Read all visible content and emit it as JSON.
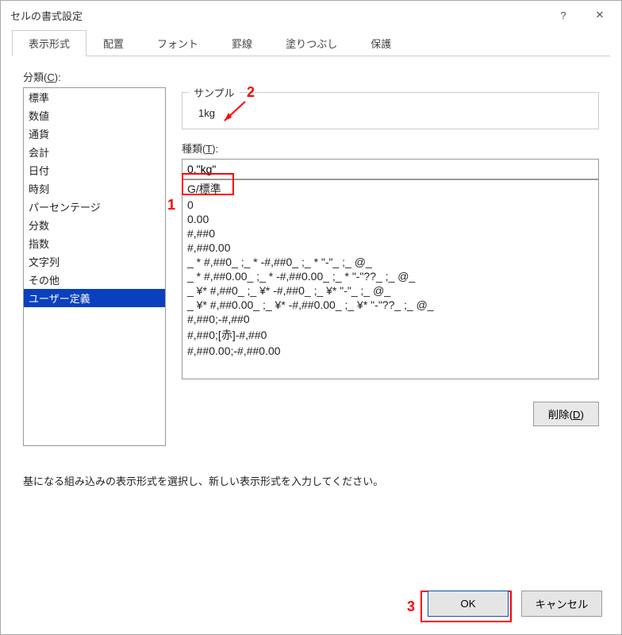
{
  "window": {
    "title": "セルの書式設定",
    "help": "?",
    "close": "✕"
  },
  "tabs": [
    {
      "label": "表示形式",
      "active": true
    },
    {
      "label": "配置"
    },
    {
      "label": "フォント"
    },
    {
      "label": "罫線"
    },
    {
      "label": "塗りつぶし"
    },
    {
      "label": "保護"
    }
  ],
  "category_label_pre": "分類(",
  "category_label_key": "C",
  "category_label_post": "):",
  "categories": [
    "標準",
    "数値",
    "通貨",
    "会計",
    "日付",
    "時刻",
    "パーセンテージ",
    "分数",
    "指数",
    "文字列",
    "その他",
    "ユーザー定義"
  ],
  "selected_category_index": 11,
  "sample": {
    "legend": "サンプル",
    "value": "1kg"
  },
  "type_label_pre": "種類(",
  "type_label_key": "T",
  "type_label_post": "):",
  "type_value": "0,\"kg\"",
  "formats": [
    "G/標準",
    "0",
    "0.00",
    "#,##0",
    "#,##0.00",
    "_ * #,##0_ ;_ * -#,##0_ ;_ * \"-\"_ ;_ @_",
    "_ * #,##0.00_ ;_ * -#,##0.00_ ;_ * \"-\"??_ ;_ @_",
    "_ ¥* #,##0_ ;_ ¥* -#,##0_ ;_ ¥* \"-\"_ ;_ @_",
    "_ ¥* #,##0.00_ ;_ ¥* -#,##0.00_ ;_ ¥* \"-\"??_ ;_ @_",
    "#,##0;-#,##0",
    "#,##0;[赤]-#,##0",
    "#,##0.00;-#,##0.00"
  ],
  "delete_label_pre": "削除(",
  "delete_label_key": "D",
  "delete_label_post": ")",
  "hint": "基になる組み込みの表示形式を選択し、新しい表示形式を入力してください。",
  "buttons": {
    "ok": "OK",
    "cancel": "キャンセル"
  },
  "annotations": {
    "n1": "1",
    "n2": "2",
    "n3": "3"
  }
}
